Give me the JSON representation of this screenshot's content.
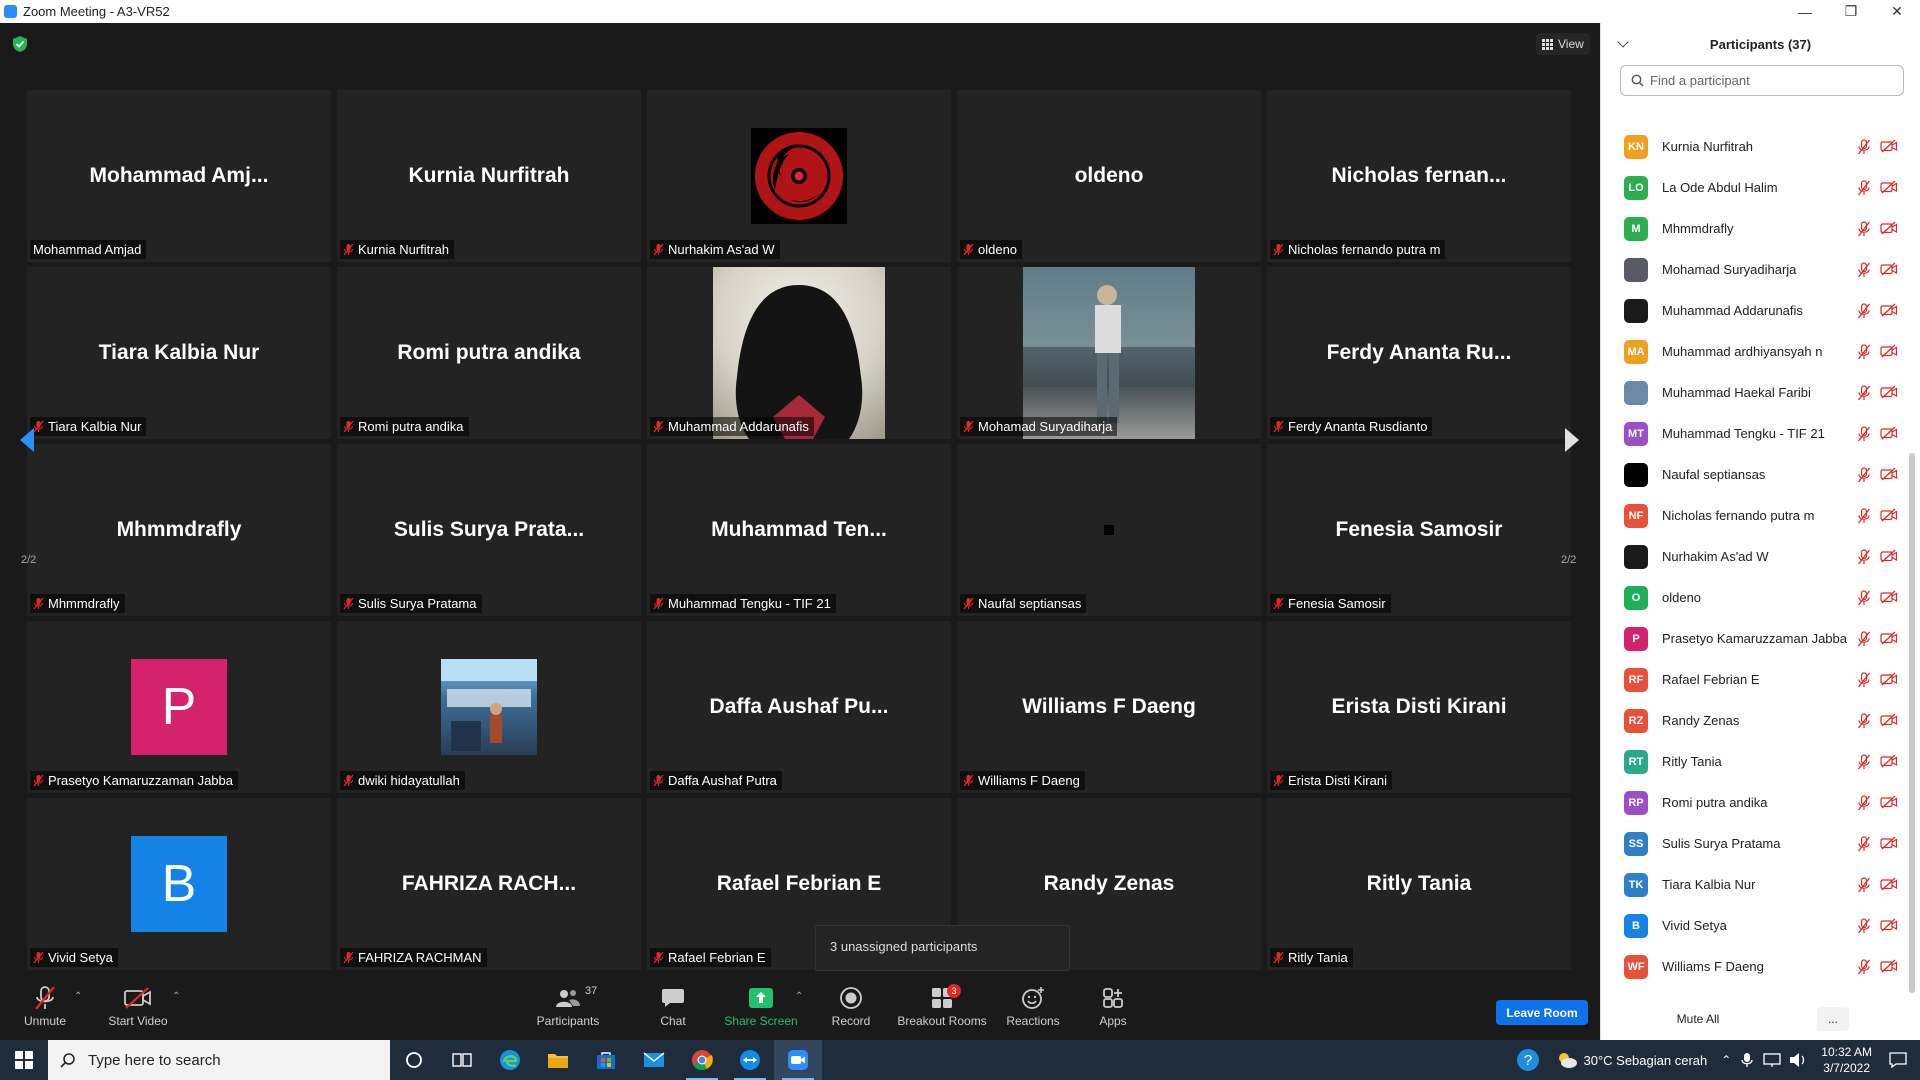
{
  "window": {
    "title": "Zoom Meeting - A3-VR52",
    "minimize": "—",
    "maximize": "❐",
    "close": "✕"
  },
  "view_button": "View",
  "grid": [
    {
      "big": "Mohammad  Amj...",
      "caption": "Mohammad Amjad",
      "muted": false,
      "avatar": null
    },
    {
      "big": "Kurnia Nurfitrah",
      "caption": "Kurnia Nurfitrah",
      "muted": true,
      "avatar": null
    },
    {
      "big": "",
      "caption": "Nurhakim As'ad W",
      "muted": true,
      "avatar": "sharingan"
    },
    {
      "big": "oldeno",
      "caption": "oldeno",
      "muted": true,
      "avatar": null
    },
    {
      "big": "Nicholas  fernan...",
      "caption": "Nicholas fernando putra m",
      "muted": true,
      "avatar": null
    },
    {
      "big": "Tiara Kalbia Nur",
      "caption": "Tiara Kalbia Nur",
      "muted": true,
      "avatar": null
    },
    {
      "big": "Romi putra andika",
      "caption": "Romi putra andika",
      "muted": true,
      "avatar": null
    },
    {
      "big": "",
      "caption": "Muhammad Addarunafis",
      "muted": true,
      "avatar": "hood"
    },
    {
      "big": "",
      "caption": "Mohamad Suryadiharja",
      "muted": true,
      "avatar": "street"
    },
    {
      "big": "Ferdy Ananta Ru...",
      "caption": "Ferdy Ananta Rusdianto",
      "muted": true,
      "avatar": null
    },
    {
      "big": "Mhmmdrafly",
      "caption": "Mhmmdrafly",
      "muted": true,
      "avatar": null
    },
    {
      "big": "Sulis Surya Prata...",
      "caption": "Sulis Surya Pratama",
      "muted": true,
      "avatar": null
    },
    {
      "big": "Muhammad  Ten...",
      "caption": "Muhammad Tengku - TIF 21",
      "muted": true,
      "avatar": null
    },
    {
      "big": "",
      "caption": "Naufal septiansas",
      "muted": true,
      "avatar": "dot"
    },
    {
      "big": "Fenesia Samosir",
      "caption": "Fenesia Samosir",
      "muted": true,
      "avatar": null
    },
    {
      "big": "",
      "caption": "Prasetyo Kamaruzzaman Jabba",
      "muted": true,
      "avatar": "letter-p"
    },
    {
      "big": "",
      "caption": "dwiki hidayatullah",
      "muted": true,
      "avatar": "photo"
    },
    {
      "big": "Daffa  Aushaf Pu...",
      "caption": "Daffa Aushaf Putra",
      "muted": true,
      "avatar": null
    },
    {
      "big": "Williams F Daeng",
      "caption": "Williams F Daeng",
      "muted": true,
      "avatar": null
    },
    {
      "big": "Erista Disti Kirani",
      "caption": "Erista Disti Kirani",
      "muted": true,
      "avatar": null
    },
    {
      "big": "",
      "caption": "Vivid Setya",
      "muted": true,
      "avatar": "letter-b"
    },
    {
      "big": "FAHRIZA  RACH...",
      "caption": "FAHRIZA RACHMAN",
      "muted": true,
      "avatar": null
    },
    {
      "big": "Rafael Febrian E",
      "caption": "Rafael Febrian E",
      "muted": true,
      "avatar": null
    },
    {
      "big": "Randy Zenas",
      "caption": "",
      "muted": false,
      "avatar": null
    },
    {
      "big": "Ritly Tania",
      "caption": "Ritly Tania",
      "muted": true,
      "avatar": null
    }
  ],
  "letters": {
    "p": "P",
    "b": "B"
  },
  "pager": {
    "left": "2/2",
    "right": "2/2"
  },
  "tooltip": "3 unassigned participants",
  "toolbar": {
    "unmute": "Unmute",
    "start_video": "Start Video",
    "participants": "Participants",
    "participants_count": "37",
    "chat": "Chat",
    "share_screen": "Share Screen",
    "record": "Record",
    "breakout_rooms": "Breakout Rooms",
    "breakout_badge": "3",
    "reactions": "Reactions",
    "apps": "Apps",
    "leave": "Leave Room"
  },
  "panel": {
    "title": "Participants (37)",
    "search_placeholder": "Find a participant",
    "mute_all": "Mute All",
    "more": "...",
    "participants": [
      {
        "initials": "KN",
        "name": "Kurnia Nurfitrah",
        "color": "#f0a01e"
      },
      {
        "initials": "LO",
        "name": "La Ode Abdul Halim",
        "color": "#2ead4e"
      },
      {
        "initials": "M",
        "name": "Mhmmdrafly",
        "color": "#2ead4e"
      },
      {
        "initials": "",
        "name": "Mohamad Suryadiharja",
        "color": "#5a5a66"
      },
      {
        "initials": "",
        "name": "Muhammad Addarunafis",
        "color": "#1a1a1a"
      },
      {
        "initials": "MA",
        "name": "Muhammad ardhiyansyah n",
        "color": "#f0a01e"
      },
      {
        "initials": "",
        "name": "Muhammad Haekal Faribi",
        "color": "#6c8aa8"
      },
      {
        "initials": "MT",
        "name": "Muhammad Tengku - TIF 21",
        "color": "#9a4fc7"
      },
      {
        "initials": "",
        "name": "Naufal septiansas",
        "color": "#000000"
      },
      {
        "initials": "NF",
        "name": "Nicholas fernando putra m",
        "color": "#e8503a"
      },
      {
        "initials": "",
        "name": "Nurhakim As'ad W",
        "color": "#1a1a1a"
      },
      {
        "initials": "O",
        "name": "oldeno",
        "color": "#1fae5a"
      },
      {
        "initials": "P",
        "name": "Prasetyo Kamaruzzaman Jabba",
        "color": "#d4226b"
      },
      {
        "initials": "RF",
        "name": "Rafael Febrian E",
        "color": "#e8503a"
      },
      {
        "initials": "RZ",
        "name": "Randy Zenas",
        "color": "#e8503a"
      },
      {
        "initials": "RT",
        "name": "Ritly Tania",
        "color": "#2aa889"
      },
      {
        "initials": "RP",
        "name": "Romi putra andika",
        "color": "#9a4fc7"
      },
      {
        "initials": "SS",
        "name": "Sulis Surya Pratama",
        "color": "#2f7fc7"
      },
      {
        "initials": "TK",
        "name": "Tiara Kalbia Nur",
        "color": "#2f7fc7"
      },
      {
        "initials": "B",
        "name": "Vivid Setya",
        "color": "#1583e6"
      },
      {
        "initials": "WF",
        "name": "Williams F Daeng",
        "color": "#e8503a"
      }
    ]
  },
  "taskbar": {
    "search_placeholder": "Type here to search",
    "weather": "30°C  Sebagian cerah",
    "time": "10:32 AM",
    "date": "3/7/2022"
  },
  "colors": {
    "accent": "#0e72ed",
    "muted_red": "#e02828",
    "share_green": "#23c16b"
  }
}
